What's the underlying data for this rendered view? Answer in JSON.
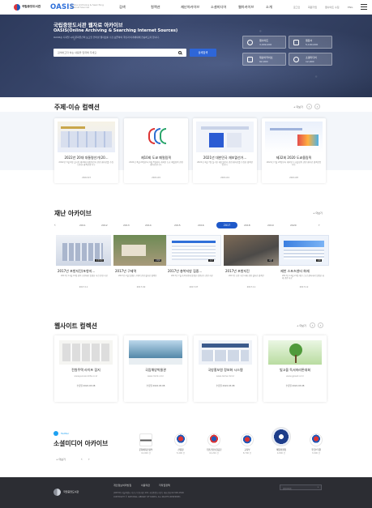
{
  "header": {
    "org_name": "국립중앙도서관",
    "logo": "OASIS",
    "logo_sub": "Online Archiving & Searching Internet Sources",
    "nav": [
      "검색",
      "컬렉션",
      "재난아카이브",
      "소셜미디어",
      "웹아카이브",
      "소개"
    ],
    "util": [
      "로그인",
      "회원가입",
      "웹사이트 수집",
      "ENG"
    ]
  },
  "hero": {
    "title": "국립중앙도서관 웹자료 아카이브",
    "subtitle": "OASIS(Online Archiving & Searching Internet Sources)",
    "desc": "OASIS는 디지털 시대 문화유산의 보고인 인터넷 웹자료를 수집·보존하여 국민과 미래세대에 전승하고자 합니다.",
    "search_placeholder": "검색하고자 하는 내용을 입력해 주세요",
    "detail_search": "상세검색",
    "stats": [
      {
        "label": "웹사이트",
        "value": "3,049,000"
      },
      {
        "label": "웹문서",
        "value": "5,100,000"
      },
      {
        "label": "재난아카이브",
        "value": "92,000"
      },
      {
        "label": "소셜미디어",
        "value": "12,000"
      }
    ]
  },
  "theme": {
    "title": "주제·이슈 컬렉션",
    "more": "+ 더보기",
    "cards": [
      {
        "title": "2022년 20대 대통령선거(20...",
        "desc": "2022년 3월 9일 실시된 제20대 대통령선거 관련 웹자료를 수집·보존한 컬렉션입니다.",
        "date": "2022.03"
      },
      {
        "title": "제10회 도쿄 패럴림픽",
        "desc": "2021년 8월 24일부터 9월 5일까지 개최된 도쿄 패럴림픽 관련 웹자료입니다.",
        "date": "2021.09"
      },
      {
        "title": "2021년 대한민국 재보궐선거...",
        "desc": "2021년 4월 7일 실시된 재보궐선거 관련 웹자료를 수집한 컬렉션입니다.",
        "date": "2021.04"
      },
      {
        "title": "제32회 2020 도쿄올림픽",
        "desc": "2021년 7월 23일부터 개최된 도쿄올림픽 관련 웹자료 컬렉션입니다.",
        "date": "2021.08"
      }
    ]
  },
  "disaster": {
    "title": "재난 아카이브",
    "more": "+ 더보기",
    "years": [
      "2011",
      "2012",
      "2013",
      "2014",
      "2015",
      "2016",
      "2017",
      "2018",
      "2019",
      "2020"
    ],
    "active_year": "2017",
    "cards": [
      {
        "title": "2017년 포항지진(포항지...",
        "desc": "2017년 11월 15일 경북 포항에서 발생한 지진 관련 자료",
        "date": "2017.11",
        "tag": "포항지진"
      },
      {
        "title": "2017년 구제역",
        "desc": "2017년 2월 발생한 구제역 관련 웹자료 컬렉션",
        "date": "2017.02",
        "tag": "구제역"
      },
      {
        "title": "2017년 충북지방 집중...",
        "desc": "2017년 7월 충북지방에 발생한 집중호우 관련 자료",
        "date": "2017.07",
        "tag": "호우"
      },
      {
        "title": "2017년 포항지진",
        "desc": "2017년 포항 지진 피해 관련 웹자료 컬렉션",
        "date": "2017.11",
        "tag": "지진"
      },
      {
        "title": "제천 스포츠센터 화재",
        "desc": "2017년 12월 21일 제천 스포츠센터에서 발생한 화재 관련 자료",
        "date": "2017.12",
        "tag": "화재"
      }
    ]
  },
  "web": {
    "title": "웹사이트 컬렉션",
    "more": "+ 더보기",
    "cards": [
      {
        "title": "전원주택 라이프 잡지",
        "url": "www.jeonwonlife.co.kr",
        "date": "수집일 2022.03.08"
      },
      {
        "title": "국립해양박물관",
        "url": "www.mmk.or.kr",
        "date": "수집일 2022.03.08"
      },
      {
        "title": "국방홍보원 정보화 시스템",
        "url": "www.dema.mil.kr",
        "date": "수집일 2022.03.08"
      },
      {
        "title": "빛고을 독서마라톤대회",
        "url": "www.gjread.or.kr",
        "date": "수집일 2022.03.08"
      }
    ]
  },
  "social": {
    "platform": "Twitter",
    "title": "소셜미디어 아카이브",
    "more": "+ 더보기",
    "accounts": [
      {
        "name": "문화체육관광부",
        "count": "12,000 건"
      },
      {
        "name": "산림청",
        "count": "5,400 건"
      },
      {
        "name": "국민건강보험공단",
        "count": "10,200 건"
      },
      {
        "name": "교육부",
        "count": "8,700 건"
      },
      {
        "name": "해양경찰청",
        "count": "4,800 건"
      },
      {
        "name": "국립수목원",
        "count": "3,900 건"
      }
    ]
  },
  "footer": {
    "org_name": "국립중앙도서관",
    "links": [
      "개인정보처리방침",
      "이용약관",
      "저작권정책"
    ],
    "address": "(06579) 서울특별시 서초구 반포대로 201 국립중앙도서관 | 대표전화 02-590-0500",
    "copyright": "COPYRIGHT © NATIONAL LIBRARY OF KOREA. ALL RIGHTS RESERVED.",
    "family_site": "관련사이트"
  },
  "colors": {
    "accent": "#1f59c9",
    "hero_bg": "#33416a",
    "footer_bg": "#2c2d33"
  }
}
